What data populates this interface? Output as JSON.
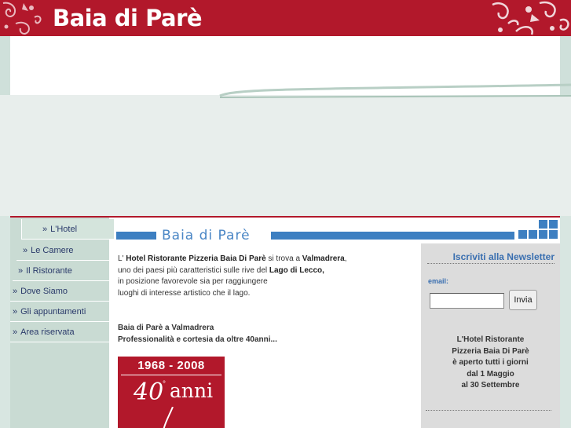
{
  "header": {
    "logo_text": "Baia di Parè",
    "brand_color": "#b2182b"
  },
  "nav": {
    "items": [
      {
        "label": "L'Hotel"
      },
      {
        "label": "Le Camere"
      },
      {
        "label": "Il Ristorante"
      },
      {
        "label": "Dove Siamo"
      },
      {
        "label": "Gli appuntamenti"
      },
      {
        "label": "Area riservata"
      }
    ],
    "arrow": "»"
  },
  "main": {
    "title": "Baia di Parè",
    "intro": {
      "p1_a": "L' ",
      "p1_b": "Hotel Ristorante Pizzeria Baia Di Parè",
      "p1_c": " si trova a ",
      "p1_d": "Valmadrera",
      "p1_e": ",",
      "p2": "uno dei paesi più caratteristici sulle rive del ",
      "p2_b": "Lago di Lecco,",
      "p3": "in posizione favorevole sia per raggiungere",
      "p4": "luoghi di interesse artistico che il lago."
    },
    "tagline1": "Baia di Parè a Valmadrera",
    "tagline2": "Professionalità e cortesia da oltre 40anni...",
    "anniversary": {
      "years": "1968 - 2008",
      "number": "40",
      "degree": "°",
      "word": "anni"
    }
  },
  "newsletter": {
    "title": "Iscriviti alla Newsletter",
    "email_label": "email:",
    "email_value": "",
    "submit_label": "Invia",
    "info": [
      "L'Hotel Ristorante",
      "Pizzeria Baia Di Parè",
      "è aperto tutti i giorni",
      "dal 1 Maggio",
      "al 30 Settembre"
    ]
  },
  "colors": {
    "accent_blue": "#3d7fc1",
    "sidebar_green": "#c9dbd3"
  }
}
